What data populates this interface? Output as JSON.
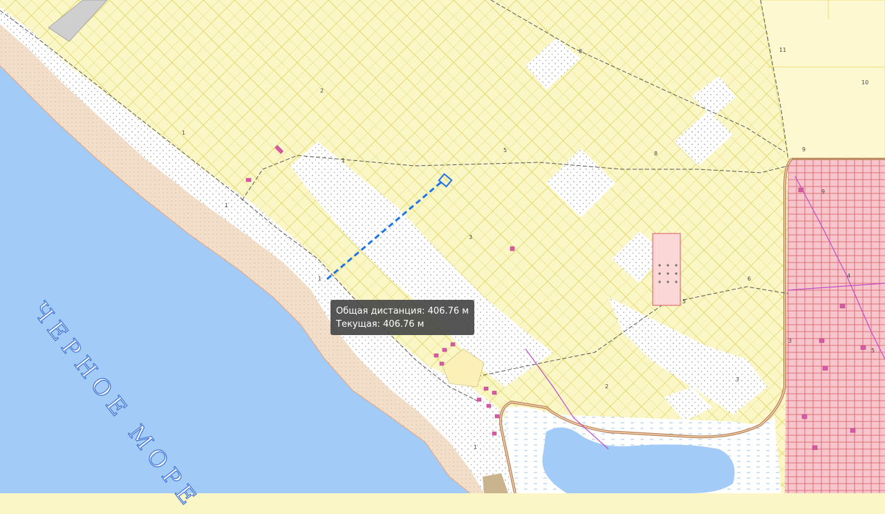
{
  "map": {
    "sea_label": "ЧЕРНОЕ МОРЕ",
    "colors": {
      "sea": "#a3cbf8",
      "zone_yellow": "#fbf6c6",
      "parcel_grid": "#e6de6a",
      "beach": "#f3dec9",
      "coast_strip": "#ffffff",
      "urban_block": "#f7c6cc",
      "urban_outline": "#d6585f",
      "road": "#b8845a",
      "measure_line": "#1f74e6"
    },
    "zone_numbers": [
      "1",
      "1",
      "1",
      "1",
      "2",
      "3",
      "5",
      "5",
      "8",
      "8",
      "9",
      "9",
      "10",
      "11",
      "3",
      "4",
      "5",
      "6",
      "2",
      "3",
      "1"
    ]
  },
  "measure": {
    "total_label": "Общая дистанция: 406.76 м",
    "current_label": "Текущая: 406.76 м"
  }
}
